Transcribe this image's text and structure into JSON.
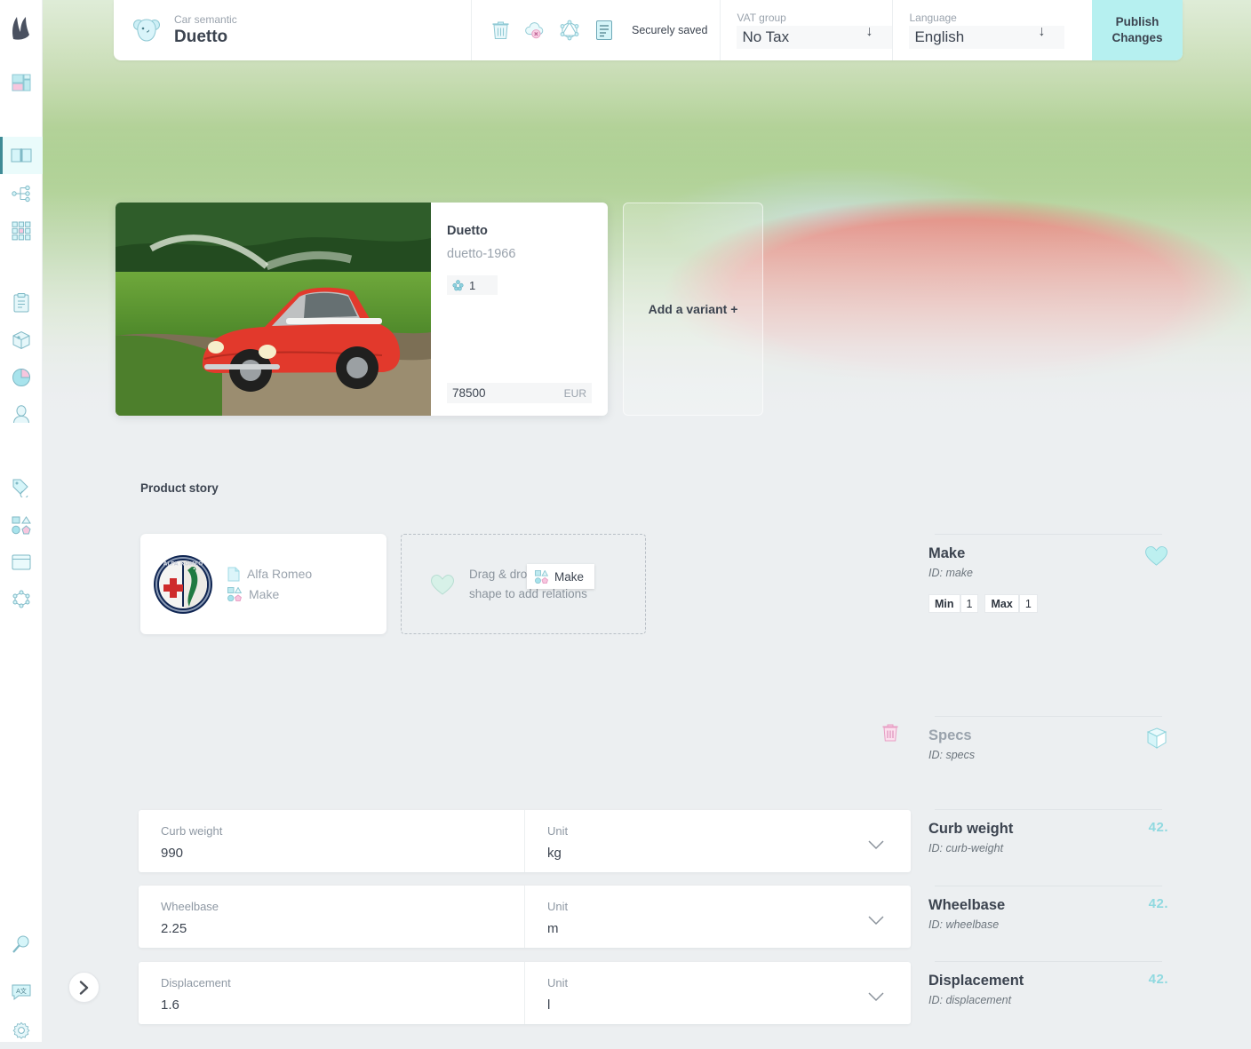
{
  "app": {
    "accent_teal": "#b6f0f0",
    "accent_pink": "#f7b9d8",
    "icon_teal": "#9fdde6",
    "text_dark": "#3c4450",
    "text_muted": "#9aa3ad",
    "panel_bg": "#eceff1"
  },
  "sidebar": {
    "logo_name": "app-logo",
    "items": [
      {
        "name": "dashboard-icon",
        "label": "Dashboard",
        "active": false
      },
      {
        "name": "catalog-book-icon",
        "label": "Catalog",
        "active": true
      },
      {
        "name": "taxonomy-tree-icon",
        "label": "Taxonomy",
        "active": false
      },
      {
        "name": "grid-matrix-icon",
        "label": "Matrix",
        "active": false
      },
      {
        "name": "clipboard-icon",
        "label": "Orders",
        "active": false
      },
      {
        "name": "cube-inventory-icon",
        "label": "Inventory",
        "active": false
      },
      {
        "name": "pie-chart-icon",
        "label": "Analytics",
        "active": false
      },
      {
        "name": "user-icon",
        "label": "Customers",
        "active": false
      },
      {
        "name": "tag-price-icon",
        "label": "Pricing",
        "active": false
      },
      {
        "name": "shapes-icon",
        "label": "Shapes",
        "active": false
      },
      {
        "name": "window-icon",
        "label": "Layouts",
        "active": false
      },
      {
        "name": "settings-nodes-icon",
        "label": "Integrations",
        "active": false
      },
      {
        "name": "search-icon",
        "label": "Search",
        "active": false
      },
      {
        "name": "translate-icon",
        "label": "Translations",
        "active": false
      },
      {
        "name": "gear-icon",
        "label": "Settings",
        "active": false
      }
    ]
  },
  "topbar": {
    "eyebrow": "Car semantic",
    "title": "Duetto",
    "logo_icon": "koala-avatar-icon",
    "actions": [
      {
        "name": "delete-icon",
        "label": "Delete"
      },
      {
        "name": "cloud-unpublish-icon",
        "label": "Unpublish"
      },
      {
        "name": "graphql-icon",
        "label": "API"
      },
      {
        "name": "document-list-icon",
        "label": "Document"
      }
    ],
    "save_status": "Securely saved",
    "vat": {
      "label": "VAT group",
      "value": "No Tax",
      "caret": "↓"
    },
    "language": {
      "label": "Language",
      "value": "English",
      "caret": "↓"
    },
    "publish_line1": "Publish",
    "publish_line2": "Changes"
  },
  "variant": {
    "image_alt": "red-convertible-car-in-field",
    "title": "Duetto",
    "slug": "duetto-1966",
    "stock_icon": "cluster-icon",
    "stock_count": "1",
    "price": "78500",
    "currency": "EUR",
    "add_variant_label": "Add a variant +"
  },
  "product_story": {
    "section_title": "Product story",
    "card": {
      "brand_logo": "alfa-romeo-logo",
      "rows": [
        {
          "icon": "document-icon",
          "label": "Alfa Romeo"
        },
        {
          "icon": "shape-relation-icon",
          "label": "Make"
        }
      ]
    },
    "dropzone": {
      "icon": "heart-icon",
      "text_line1": "Drag & drop",
      "text_line2": "shape to add relations",
      "chip_icon": "shape-relation-icon",
      "chip_label": "Make"
    },
    "delete_icon": "delete-component-icon"
  },
  "attributes": [
    {
      "label": "Curb weight",
      "value": "990",
      "unit_label": "Unit",
      "unit_value": "kg"
    },
    {
      "label": "Wheelbase",
      "value": "2.25",
      "unit_label": "Unit",
      "unit_value": "m"
    },
    {
      "label": "Displacement",
      "value": "1.6",
      "unit_label": "Unit",
      "unit_value": "l"
    }
  ],
  "shape_panel": [
    {
      "name": "Make",
      "id": "ID: make",
      "icon": "heart-icon",
      "muted": false,
      "has_minmax": true,
      "min_label": "Min",
      "min_value": "1",
      "max_label": "Max",
      "max_value": "1"
    },
    {
      "name": "Specs",
      "id": "ID: specs",
      "icon": "chunk-3d-icon",
      "muted": true,
      "has_minmax": false
    },
    {
      "name": "Curb weight",
      "id": "ID: curb-weight",
      "icon": "number-42-icon",
      "muted": false,
      "has_minmax": false
    },
    {
      "name": "Wheelbase",
      "id": "ID: wheelbase",
      "icon": "number-42-icon",
      "muted": false,
      "has_minmax": false
    },
    {
      "name": "Displacement",
      "id": "ID: displacement",
      "icon": "number-42-icon",
      "muted": false,
      "has_minmax": false
    }
  ],
  "pager": {
    "icon": "chevron-right-icon"
  }
}
